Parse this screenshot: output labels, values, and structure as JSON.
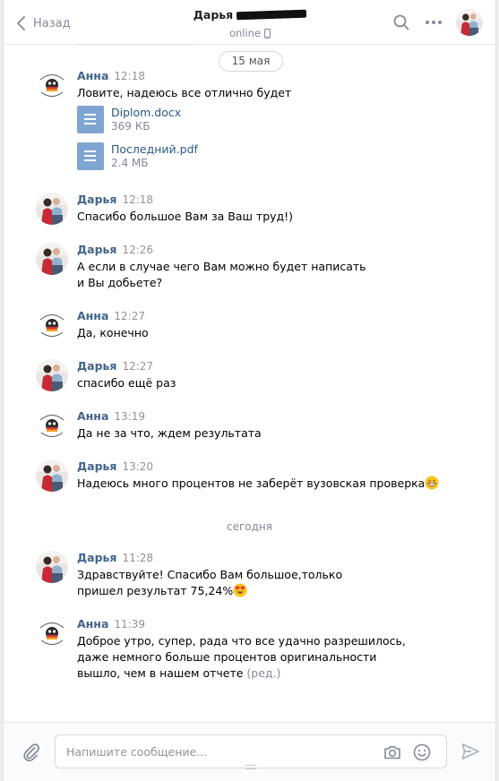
{
  "header": {
    "back_label": "Назад",
    "contact_name": "Дарья",
    "status": "online"
  },
  "dates": {
    "first": "15 мая",
    "second": "сегодня"
  },
  "messages": [
    {
      "author": "Анна",
      "time": "12:18",
      "text": "Ловите, надеюсь все отлично будет",
      "attachments": [
        {
          "name": "Diplom.docx",
          "size": "369 КБ"
        },
        {
          "name": "Последний.pdf",
          "size": "2.4 МБ"
        }
      ]
    },
    {
      "author": "Дарья",
      "time": "12:18",
      "text": "Спасибо большое Вам за Ваш труд!)"
    },
    {
      "author": "Дарья",
      "time": "12:26",
      "text": "А если в случае чего Вам можно будет написать и Вы добьете?"
    },
    {
      "author": "Анна",
      "time": "12:27",
      "text": "Да, конечно"
    },
    {
      "author": "Дарья",
      "time": "12:27",
      "text": "спасибо ещё раз"
    },
    {
      "author": "Анна",
      "time": "13:19",
      "text": "Да не за что, ждем результата"
    },
    {
      "author": "Дарья",
      "time": "13:20",
      "text": "Надеюсь много процентов не заберёт вузовская проверка"
    },
    {
      "author": "Дарья",
      "time": "11:28",
      "text": "Здравствуйте! Спасибо Вам большое,только пришел результат 75,24%"
    },
    {
      "author": "Анна",
      "time": "11:39",
      "text": "Доброе утро, супер, рада что все удачно разрешилось, даже немного больше процентов оригинальности вышло, чем в нашем отчете",
      "edited_label": "(ред.)"
    }
  ],
  "composer": {
    "placeholder": "Напишите сообщение..."
  },
  "icons": {
    "back": "chevron-left-icon",
    "search": "search-icon",
    "more": "more-dots-icon",
    "attach": "paperclip-icon",
    "camera": "camera-icon",
    "smile": "smile-icon",
    "send": "send-icon"
  },
  "colors": {
    "author_link": "#42648b",
    "doc_link": "#2a5885",
    "doc_icon": "#7fa6d1"
  }
}
